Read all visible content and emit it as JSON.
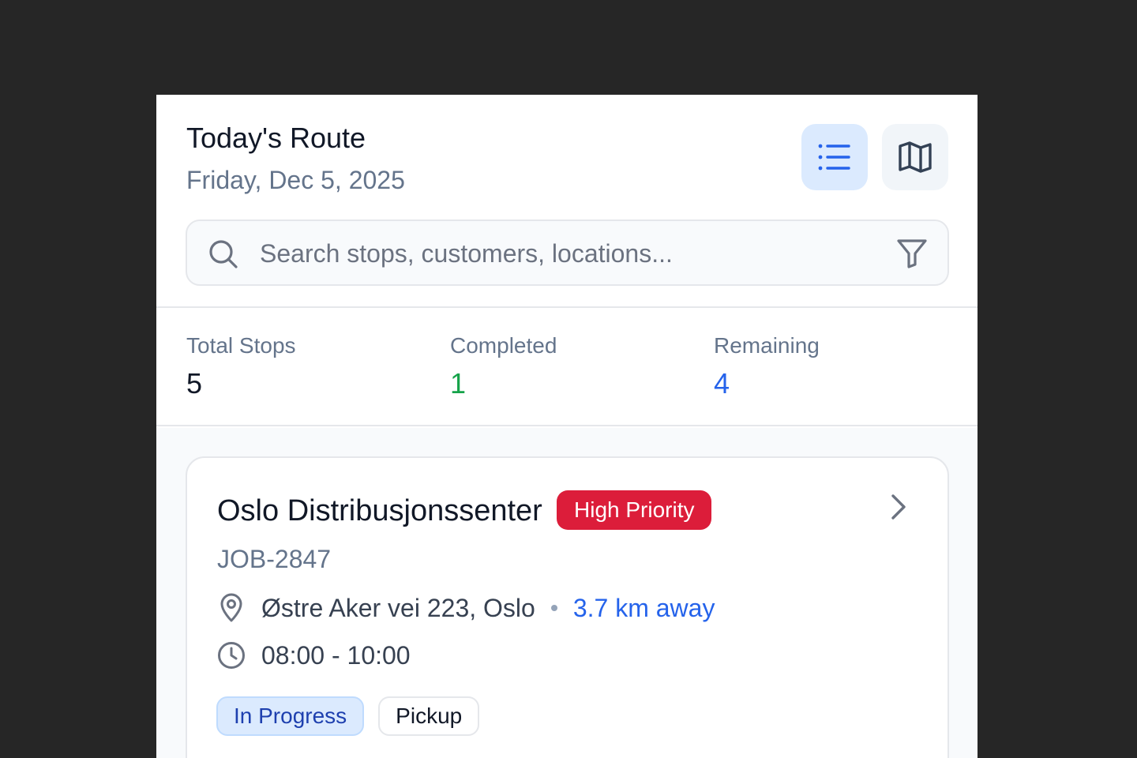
{
  "header": {
    "title": "Today's Route",
    "date": "Friday, Dec 5, 2025",
    "view_buttons": [
      {
        "name": "list-view",
        "icon": "list-icon",
        "active": true
      },
      {
        "name": "map-view",
        "icon": "map-icon",
        "active": false
      }
    ]
  },
  "search": {
    "placeholder": "Search stops, customers, locations...",
    "value": "",
    "icon": "search-icon",
    "filter_icon": "filter-icon"
  },
  "stats": {
    "total_label": "Total Stops",
    "total_value": "5",
    "completed_label": "Completed",
    "completed_value": "1",
    "remaining_label": "Remaining",
    "remaining_value": "4"
  },
  "stops": [
    {
      "name": "Oslo Distribusjonssenter",
      "priority": "High Priority",
      "job_id": "JOB-2847",
      "address": "Østre Aker vei 223, Oslo",
      "distance": "3.7 km away",
      "time_window": "08:00 - 10:00",
      "status": "In Progress",
      "type": "Pickup"
    }
  ],
  "colors": {
    "accent": "#2563eb",
    "priority_high": "#dc1d3a",
    "completed": "#16a34a",
    "status_bg": "#dbeafe"
  }
}
